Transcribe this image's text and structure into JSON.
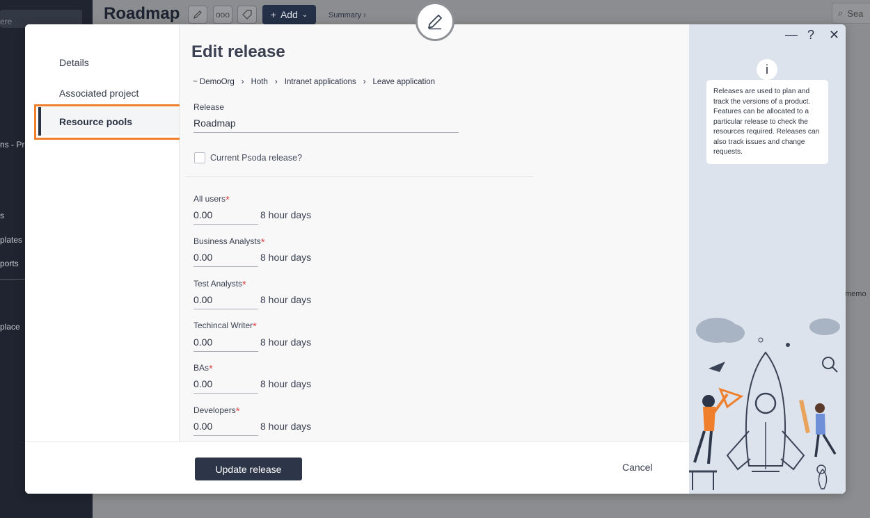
{
  "background": {
    "sidebar_fragments": [
      "ere",
      "ns - Pro",
      "s",
      "plates",
      "ports",
      "place"
    ],
    "page_title": "Roadmap",
    "add_label": "Add",
    "summary_label": "Summary ›",
    "search_label": "Sea",
    "memo_fragment": "memo"
  },
  "modal": {
    "left_nav": {
      "items": [
        {
          "label": "Details"
        },
        {
          "label": "Associated project"
        },
        {
          "label": "Resource pools",
          "active": true
        }
      ]
    },
    "heading": "Edit release",
    "breadcrumb": [
      "~ DemoOrg",
      "Hoth",
      "Intranet applications",
      "Leave application"
    ],
    "breadcrumb_separator": "›",
    "release": {
      "label": "Release",
      "value": "Roadmap"
    },
    "checkbox": {
      "label": "Current Psoda release?",
      "checked": false
    },
    "required_marker": "*",
    "resource_pools": [
      {
        "label": "All users",
        "value": "0.00",
        "unit": "8 hour days"
      },
      {
        "label": "Business Analysts",
        "value": "0.00",
        "unit": "8 hour days"
      },
      {
        "label": "Test Analysts",
        "value": "0.00",
        "unit": "8 hour days"
      },
      {
        "label": "Techincal Writer",
        "value": "0.00",
        "unit": "8 hour days"
      },
      {
        "label": "BAs",
        "value": "0.00",
        "unit": "8 hour days"
      },
      {
        "label": "Developers",
        "value": "0.00",
        "unit": "8 hour days"
      }
    ],
    "footer": {
      "primary_button": "Update release",
      "cancel_button": "Cancel"
    },
    "info": {
      "icon_glyph": "i",
      "text": "Releases are used to plan and track the versions of a product. Features can be allocated to a particular release to check the resources required. Releases can also track issues and change requests."
    },
    "window_controls": {
      "minimize": "—",
      "help": "?",
      "close": "✕"
    }
  },
  "colors": {
    "accent_orange": "#ef7f2c",
    "primary_dark": "#2d3648",
    "required_red": "#e14b4b",
    "info_panel_bg": "#dde3ec"
  }
}
